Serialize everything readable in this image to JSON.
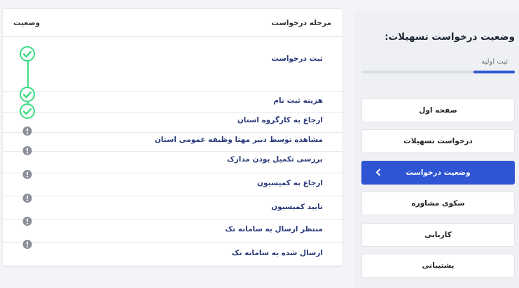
{
  "stages_table": {
    "col_stage": "مرحله درخواست",
    "col_status": "وضعیت",
    "rows": [
      {
        "label": "ثبت درخواست",
        "status": "done",
        "status_icon": "check-circle-icon"
      },
      {
        "label": "هزینه ثبت نام",
        "status": "done",
        "status_icon": "check-circle-icon"
      },
      {
        "label": "ارجاع به کارگروه استان",
        "status": "done",
        "status_icon": "check-circle-icon"
      },
      {
        "label": "مشاهده توسط دبیر مهتا وظیفه عمومی استان",
        "status": "pending",
        "status_icon": "exclamation-circle-icon"
      },
      {
        "label": "بررسی تکمیل بودن مدارک",
        "status": "pending",
        "status_icon": "exclamation-circle-icon"
      },
      {
        "label": "ارجاع به کمیسیون",
        "status": "pending",
        "status_icon": "exclamation-circle-icon"
      },
      {
        "label": "تایید کمیسیون",
        "status": "pending",
        "status_icon": "exclamation-circle-icon"
      },
      {
        "label": "منتظر ارسال به سامانه تک",
        "status": "pending",
        "status_icon": "exclamation-circle-icon"
      },
      {
        "label": "ارسال شده به سامانه تک",
        "status": "pending",
        "status_icon": "exclamation-circle-icon"
      }
    ]
  },
  "sidebar": {
    "title": "وضعیت درخواست تسهیلات:",
    "progress_label": "ثبت اولیه",
    "progress_fraction": 0.27,
    "menu": [
      {
        "label": "صفحه اول",
        "active": false
      },
      {
        "label": "درخواست تسهیلات",
        "active": false
      },
      {
        "label": "وضعیت درخواست",
        "active": true,
        "icon": "chevron-left-icon"
      },
      {
        "label": "سکوی مشاوره",
        "active": false
      },
      {
        "label": "کاریابی",
        "active": false
      },
      {
        "label": "پشتیبانی",
        "active": false
      }
    ]
  },
  "colors": {
    "accent": "#2f55d4",
    "done": "#3ddc84",
    "pending": "#8a8f99",
    "stage_text": "#2a3a7a"
  }
}
